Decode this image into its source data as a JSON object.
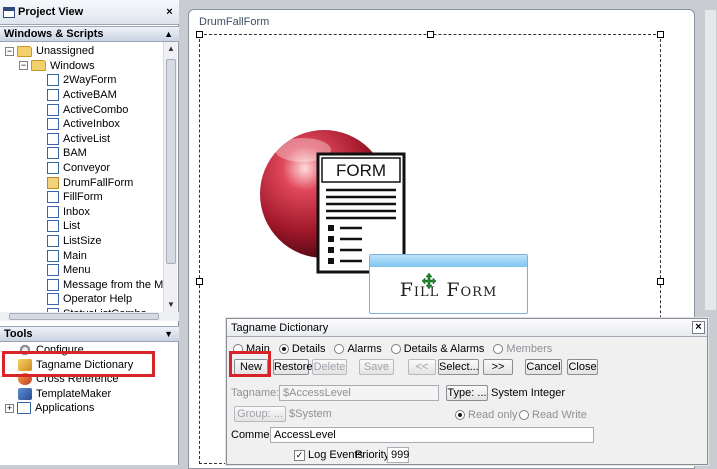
{
  "project_view": {
    "title": "Project View",
    "close": "×",
    "windows_scripts": {
      "header": "Windows & Scripts",
      "chevron": "▲",
      "unassigned": "Unassigned",
      "windows": "Windows",
      "items": [
        "2WayForm",
        "ActiveBAM",
        "ActiveCombo",
        "ActiveInbox",
        "ActiveList",
        "BAM",
        "Conveyor",
        "DrumFallForm",
        "FillForm",
        "Inbox",
        "List",
        "ListSize",
        "Main",
        "Menu",
        "Message from the Mar",
        "Operator Help",
        "StatusListCombo"
      ],
      "highlighted_item": "DrumFallForm"
    },
    "tools": {
      "header": "Tools",
      "chevron": "▼",
      "items": [
        "Configure",
        "Tagname Dictionary",
        "Cross Reference",
        "TemplateMaker",
        "Applications"
      ]
    }
  },
  "design": {
    "window_title": "DrumFallForm",
    "graphic_label": "FORM",
    "fill_button": "Fill Form"
  },
  "dialog": {
    "title": "Tagname Dictionary",
    "close": "×",
    "views": [
      {
        "label": "Main",
        "selected": false,
        "disabled": false
      },
      {
        "label": "Details",
        "selected": true,
        "disabled": false
      },
      {
        "label": "Alarms",
        "selected": false,
        "disabled": false
      },
      {
        "label": "Details & Alarms",
        "selected": false,
        "disabled": false
      },
      {
        "label": "Members",
        "selected": false,
        "disabled": true
      }
    ],
    "buttons": {
      "new": "New",
      "restore": "Restore",
      "delete": "Delete",
      "save": "Save",
      "prev": "<<",
      "select": "Select...",
      "next": ">>",
      "cancel": "Cancel",
      "close_btn": "Close"
    },
    "tagname_label": "Tagname:",
    "tagname_value": "$AccessLevel",
    "type_button": "Type: ...",
    "type_value": "System Integer",
    "group_button": "Group: ...",
    "group_value": "$System",
    "read_only": "Read only",
    "read_write": "Read Write",
    "comment_label": "Comment:",
    "comment_value": "AccessLevel",
    "log_events": "Log Events",
    "priority_label": "Priority:",
    "priority_value": "999"
  }
}
